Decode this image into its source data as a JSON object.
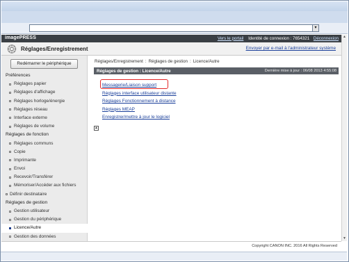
{
  "browser": {
    "address_dropdown": "▾"
  },
  "topbar": {
    "brand": "imagePRESS",
    "portal_link": "Vers le portail",
    "login_label": "Identité de connexion : 7654321",
    "logout_link": "Déconnexion"
  },
  "header": {
    "title": "Réglages/Enregistrement",
    "email_link": "Envoyer par e-mail à l'administrateur système"
  },
  "sidebar": {
    "restart_button": "Redémarrer le périphérique",
    "sections": [
      {
        "label": "Préférences",
        "items": [
          {
            "label": "Réglages papier"
          },
          {
            "label": "Réglages d'affichage"
          },
          {
            "label": "Réglages horloge/énergie"
          },
          {
            "label": "Réglages réseau"
          },
          {
            "label": "Interface externe"
          },
          {
            "label": "Réglages de volume"
          }
        ]
      },
      {
        "label": "Réglages de fonction",
        "items": [
          {
            "label": "Réglages communs"
          },
          {
            "label": "Copie"
          },
          {
            "label": "Imprimante"
          },
          {
            "label": "Envoi"
          },
          {
            "label": "Recevoir/Transférer"
          },
          {
            "label": "Mémoriser/Accéder aux fichiers"
          }
        ]
      }
    ],
    "define_destination": "Définir destinataire",
    "management_section": "Réglages de gestion",
    "management_items": [
      {
        "label": "Gestion utilisateur"
      },
      {
        "label": "Gestion du périphérique"
      },
      {
        "label": "Licence/Autre",
        "active": true
      },
      {
        "label": "Gestion des données"
      }
    ]
  },
  "main": {
    "breadcrumb": [
      "Réglages/Enregistrement",
      "Réglages de gestion",
      "Licence/Autre"
    ],
    "breadcrumb_sep": ":",
    "panel_title": "Réglages de gestion : Licence/Autre",
    "last_update": "Dernière mise à jour : 06/08 2013 4:55:08",
    "links": [
      "Messagerie/Liaison support",
      "Réglages interface utilisateur distante",
      "Réglages Fonctionnement à distance",
      "Réglages MEAP",
      "Enregistrer/mettre à jour le logiciel"
    ],
    "to_top": "▲"
  },
  "footer": {
    "copyright": "Copyright CANON INC. 2016 All Rights Reserved"
  },
  "colors": {
    "topbar_bg": "#3a3f44",
    "link": "#1a3f9a",
    "highlight": "#e22626",
    "sidebar_bg": "#ebebeb"
  }
}
